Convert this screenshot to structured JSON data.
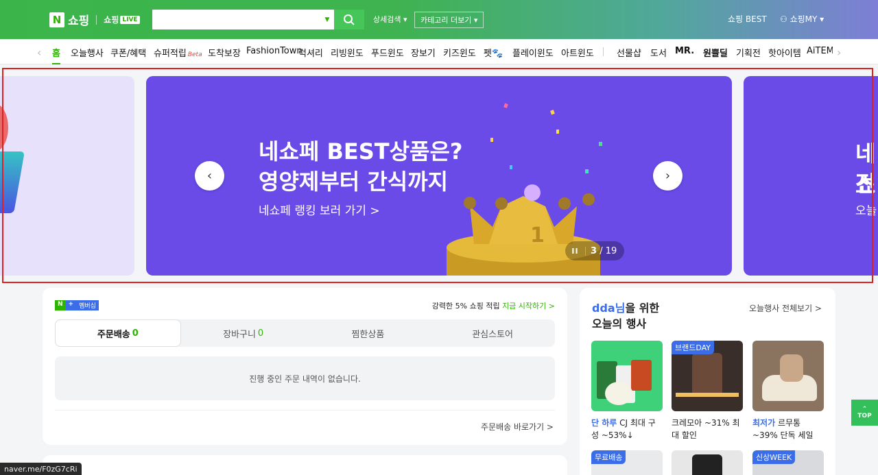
{
  "header": {
    "logo_n": "N",
    "logo_text": "쇼핑",
    "live_text": "쇼핑",
    "live_badge": "LIVE",
    "search_value": "",
    "detail_search": "상세검색",
    "category_more": "카테고리 더보기",
    "best": "쇼핑 BEST",
    "my": "쇼핑MY"
  },
  "nav": {
    "items": [
      "홈",
      "오늘행사",
      "쿠폰/혜택",
      "슈퍼적립",
      "도착보장",
      "FashionTown",
      "럭셔리",
      "리빙윈도",
      "푸드윈도",
      "장보기",
      "키즈윈도",
      "펫",
      "플레이윈도",
      "아트윈도",
      "선물샵",
      "도서",
      "MR.",
      "원쁠딜",
      "기획전",
      "핫아이템",
      "AiTEMS"
    ],
    "beta": "Beta"
  },
  "carousel": {
    "title_line1": "네쇼페 BEST상품은?",
    "title_line2": "영양제부터 간식까지",
    "subtitle": "네쇼페 랭킹 보러 가기 >",
    "current": "3",
    "total": "/ 19",
    "pause": "II",
    "next_slide_line1": "네쇼",
    "next_slide_line2": "전",
    "next_slide_line3": "오늘"
  },
  "membership": {
    "badge_n": "N",
    "badge_plus": "+",
    "badge_label": "멤버십",
    "promo": "강력한 5% 쇼핑 적립",
    "promo_cta": "지금 시작하기 >",
    "tabs": [
      {
        "label": "주문배송",
        "count": "0"
      },
      {
        "label": "장바구니",
        "count": "0"
      },
      {
        "label": "찜한상품",
        "count": ""
      },
      {
        "label": "관심스토어",
        "count": ""
      }
    ],
    "empty_text": "진행 중인 주문 내역이 없습니다.",
    "goto": "주문배송 바로가기 >"
  },
  "events": {
    "user": "dda님",
    "title_rest": "을 위한",
    "title_line2": "오늘의 행사",
    "all": "오늘행사 전체보기 >",
    "cards": [
      {
        "tag": "",
        "hl": "단 하루",
        "text": " CJ 최대 구성 ~53%↓"
      },
      {
        "tag": "브랜드DAY",
        "hl": "",
        "text": "크레모아 ~31% 최대 할인"
      },
      {
        "tag": "",
        "hl": "최저가",
        "text": " 르무통 ~39% 단독 세일"
      }
    ],
    "row2_tags": [
      "무료배송",
      "",
      "신상WEEK"
    ]
  },
  "top_button": "TOP",
  "status_url": "naver.me/F0zG7cRi",
  "colors": {
    "brand_green": "#2db400",
    "banner_purple": "#6a4be8",
    "accent_blue": "#3b6de8"
  }
}
